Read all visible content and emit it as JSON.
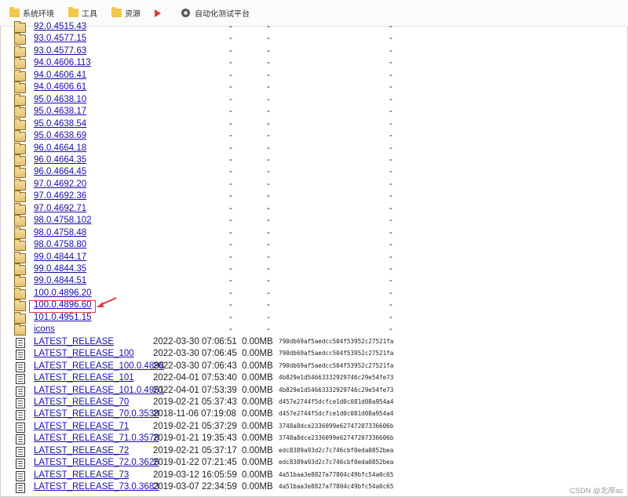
{
  "bookmarks": [
    {
      "label": "系统环境",
      "icon": "folder-icon"
    },
    {
      "label": "工具",
      "icon": "folder-icon"
    },
    {
      "label": "资源",
      "icon": "folder-icon"
    },
    {
      "label": "",
      "icon": "play-icon"
    },
    {
      "label": "自动化测试平台",
      "icon": "globe-icon"
    }
  ],
  "directories": [
    "92.0.4515.43",
    "93.0.4577.15",
    "93.0.4577.63",
    "94.0.4606.113",
    "94.0.4606.41",
    "94.0.4606.61",
    "95.0.4638.10",
    "95.0.4638.17",
    "95.0.4638.54",
    "95.0.4638.69",
    "96.0.4664.18",
    "96.0.4664.35",
    "96.0.4664.45",
    "97.0.4692.20",
    "97.0.4692.36",
    "97.0.4692.71",
    "98.0.4758.102",
    "98.0.4758.48",
    "98.0.4758.80",
    "99.0.4844.17",
    "99.0.4844.35",
    "99.0.4844.51",
    "100.0.4896.20",
    "100.0.4896.60",
    "101.0.4951.15",
    "icons"
  ],
  "dash": "-",
  "files": [
    {
      "name": "LATEST_RELEASE",
      "date": "2022-03-30 07:06:51",
      "size": "0.00MB",
      "hash": "790db69af5aedcc504f53952c27521fa"
    },
    {
      "name": "LATEST_RELEASE_100",
      "date": "2022-03-30 07:06:45",
      "size": "0.00MB",
      "hash": "790db69af5aedcc504f53952c27521fa"
    },
    {
      "name": "LATEST_RELEASE_100.0.4896",
      "date": "2022-03-30 07:06:43",
      "size": "0.00MB",
      "hash": "790db69af5aedcc504f53952c27521fa"
    },
    {
      "name": "LATEST_RELEASE_101",
      "date": "2022-04-01 07:53:40",
      "size": "0.00MB",
      "hash": "4b829e1d54663332929746c29e54fe73"
    },
    {
      "name": "LATEST_RELEASE_101.0.4951",
      "date": "2022-04-01 07:53:39",
      "size": "0.00MB",
      "hash": "4b829e1d54663332929746c29e54fe73"
    },
    {
      "name": "LATEST_RELEASE_70",
      "date": "2019-02-21 05:37:43",
      "size": "0.00MB",
      "hash": "d457e2744f5dcfce1d0c081d08a954a4"
    },
    {
      "name": "LATEST_RELEASE_70.0.3538",
      "date": "2018-11-06 07:19:08",
      "size": "0.00MB",
      "hash": "d457e2744f5dcfce1d0c081d08a954a4"
    },
    {
      "name": "LATEST_RELEASE_71",
      "date": "2019-02-21 05:37:29",
      "size": "0.00MB",
      "hash": "3748a8dce2336099e62747207336606b"
    },
    {
      "name": "LATEST_RELEASE_71.0.3578",
      "date": "2019-01-21 19:35:43",
      "size": "0.00MB",
      "hash": "3748a8dce2336099e62747207336606b"
    },
    {
      "name": "LATEST_RELEASE_72",
      "date": "2019-02-21 05:37:17",
      "size": "0.00MB",
      "hash": "edc8389a93d2c7c746cbf0eda0852bea"
    },
    {
      "name": "LATEST_RELEASE_72.0.3626",
      "date": "2019-01-22 07:21:45",
      "size": "0.00MB",
      "hash": "edc8389a93d2c7c746cbf0eda0852bea"
    },
    {
      "name": "LATEST_RELEASE_73",
      "date": "2019-03-12 16:05:59",
      "size": "0.00MB",
      "hash": "4a51baa3e8827a77804c49bfc54a0c65"
    },
    {
      "name": "LATEST_RELEASE_73.0.3683",
      "date": "2019-03-07 22:34:59",
      "size": "0.00MB",
      "hash": "4a51baa3e8827a77804c49bfc54a0c65"
    }
  ],
  "highlighted_directory": "100.0.4896.60",
  "watermark": "CSDN @北岸ac",
  "colors": {
    "link": "#1a0dab",
    "highlight": "#e23b3b",
    "folder": "#e9c170"
  }
}
